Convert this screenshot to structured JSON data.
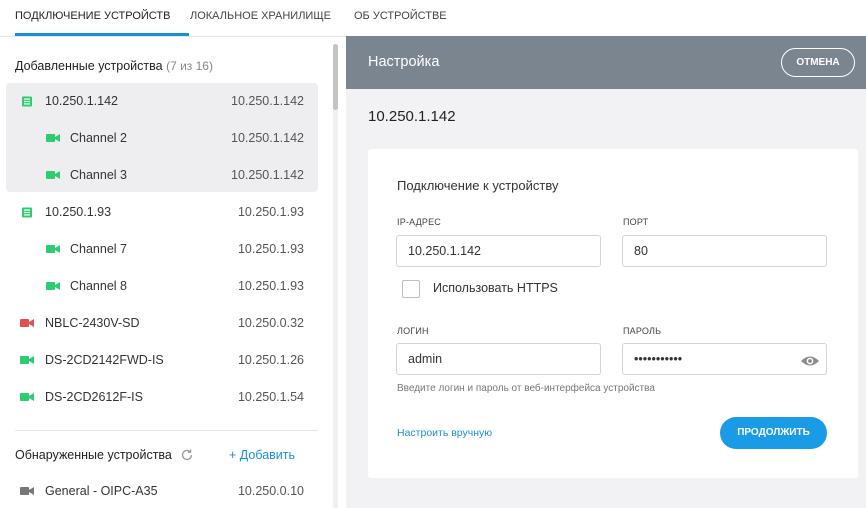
{
  "tabs": [
    {
      "label": "ПОДКЛЮЧЕНИЕ УСТРОЙСТВ",
      "active": true
    },
    {
      "label": "ЛОКАЛЬНОЕ ХРАНИЛИЩЕ",
      "active": false
    },
    {
      "label": "ОБ УСТРОЙСТВЕ",
      "active": false
    }
  ],
  "added": {
    "title": "Добавленные устройства",
    "count": "(7 из 16)",
    "rows": [
      {
        "label": "10.250.1.142",
        "ip": "10.250.1.142",
        "icon": "recorder-icon"
      },
      {
        "label": "Channel 2",
        "ip": "10.250.1.142",
        "icon": "camera-icon"
      },
      {
        "label": "Channel 3",
        "ip": "10.250.1.142",
        "icon": "camera-icon"
      },
      {
        "label": "10.250.1.93",
        "ip": "10.250.1.93",
        "icon": "recorder-icon"
      },
      {
        "label": "Channel 7",
        "ip": "10.250.1.93",
        "icon": "camera-icon"
      },
      {
        "label": "Channel 8",
        "ip": "10.250.1.93",
        "icon": "camera-icon"
      },
      {
        "label": "NBLC-2430V-SD",
        "ip": "10.250.0.32",
        "icon": "camera-icon"
      },
      {
        "label": "DS-2CD2142FWD-IS",
        "ip": "10.250.1.26",
        "icon": "camera-icon"
      },
      {
        "label": "DS-2CD2612F-IS",
        "ip": "10.250.1.54",
        "icon": "camera-icon"
      }
    ]
  },
  "discovered": {
    "title": "Обнаруженные устройства",
    "add_label": "+ Добавить",
    "rows": [
      {
        "label": "General - OIPC-A35",
        "ip": "10.250.0.10",
        "icon": "camera-icon"
      }
    ]
  },
  "colors": {
    "accent": "#1a9be6",
    "green": "#2ecc71",
    "red": "#e05050",
    "gray": "#777777",
    "header": "#7b8590"
  },
  "setup": {
    "header_title": "Настройка",
    "cancel_label": "ОТМЕНА",
    "device_title": "10.250.1.142",
    "card_title": "Подключение к устройству",
    "ip_label": "IP-АДРЕС",
    "ip_value": "10.250.1.142",
    "port_label": "ПОРТ",
    "port_value": "80",
    "https_label": "Использовать HTTPS",
    "login_label": "ЛОГИН",
    "login_value": "admin",
    "password_label": "ПАРОЛЬ",
    "password_value": "•••••••••••",
    "hint": "Введите логин и пароль от веб-интерфейса устройства",
    "manual_link": "Настроить вручную",
    "continue_label": "ПРОДОЛЖИТЬ"
  }
}
